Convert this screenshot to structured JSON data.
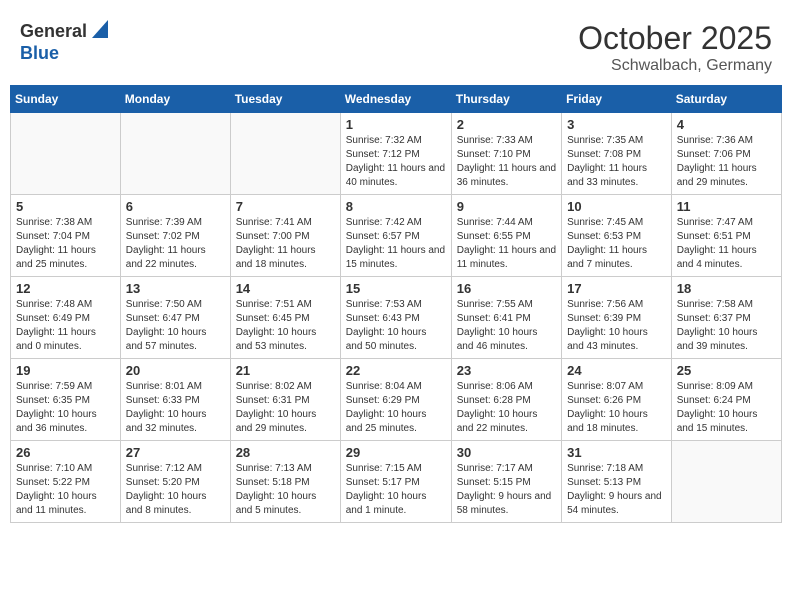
{
  "header": {
    "logo_general": "General",
    "logo_blue": "Blue",
    "month": "October 2025",
    "location": "Schwalbach, Germany"
  },
  "weekdays": [
    "Sunday",
    "Monday",
    "Tuesday",
    "Wednesday",
    "Thursday",
    "Friday",
    "Saturday"
  ],
  "weeks": [
    [
      {
        "day": "",
        "info": ""
      },
      {
        "day": "",
        "info": ""
      },
      {
        "day": "",
        "info": ""
      },
      {
        "day": "1",
        "info": "Sunrise: 7:32 AM\nSunset: 7:12 PM\nDaylight: 11 hours and 40 minutes."
      },
      {
        "day": "2",
        "info": "Sunrise: 7:33 AM\nSunset: 7:10 PM\nDaylight: 11 hours and 36 minutes."
      },
      {
        "day": "3",
        "info": "Sunrise: 7:35 AM\nSunset: 7:08 PM\nDaylight: 11 hours and 33 minutes."
      },
      {
        "day": "4",
        "info": "Sunrise: 7:36 AM\nSunset: 7:06 PM\nDaylight: 11 hours and 29 minutes."
      }
    ],
    [
      {
        "day": "5",
        "info": "Sunrise: 7:38 AM\nSunset: 7:04 PM\nDaylight: 11 hours and 25 minutes."
      },
      {
        "day": "6",
        "info": "Sunrise: 7:39 AM\nSunset: 7:02 PM\nDaylight: 11 hours and 22 minutes."
      },
      {
        "day": "7",
        "info": "Sunrise: 7:41 AM\nSunset: 7:00 PM\nDaylight: 11 hours and 18 minutes."
      },
      {
        "day": "8",
        "info": "Sunrise: 7:42 AM\nSunset: 6:57 PM\nDaylight: 11 hours and 15 minutes."
      },
      {
        "day": "9",
        "info": "Sunrise: 7:44 AM\nSunset: 6:55 PM\nDaylight: 11 hours and 11 minutes."
      },
      {
        "day": "10",
        "info": "Sunrise: 7:45 AM\nSunset: 6:53 PM\nDaylight: 11 hours and 7 minutes."
      },
      {
        "day": "11",
        "info": "Sunrise: 7:47 AM\nSunset: 6:51 PM\nDaylight: 11 hours and 4 minutes."
      }
    ],
    [
      {
        "day": "12",
        "info": "Sunrise: 7:48 AM\nSunset: 6:49 PM\nDaylight: 11 hours and 0 minutes."
      },
      {
        "day": "13",
        "info": "Sunrise: 7:50 AM\nSunset: 6:47 PM\nDaylight: 10 hours and 57 minutes."
      },
      {
        "day": "14",
        "info": "Sunrise: 7:51 AM\nSunset: 6:45 PM\nDaylight: 10 hours and 53 minutes."
      },
      {
        "day": "15",
        "info": "Sunrise: 7:53 AM\nSunset: 6:43 PM\nDaylight: 10 hours and 50 minutes."
      },
      {
        "day": "16",
        "info": "Sunrise: 7:55 AM\nSunset: 6:41 PM\nDaylight: 10 hours and 46 minutes."
      },
      {
        "day": "17",
        "info": "Sunrise: 7:56 AM\nSunset: 6:39 PM\nDaylight: 10 hours and 43 minutes."
      },
      {
        "day": "18",
        "info": "Sunrise: 7:58 AM\nSunset: 6:37 PM\nDaylight: 10 hours and 39 minutes."
      }
    ],
    [
      {
        "day": "19",
        "info": "Sunrise: 7:59 AM\nSunset: 6:35 PM\nDaylight: 10 hours and 36 minutes."
      },
      {
        "day": "20",
        "info": "Sunrise: 8:01 AM\nSunset: 6:33 PM\nDaylight: 10 hours and 32 minutes."
      },
      {
        "day": "21",
        "info": "Sunrise: 8:02 AM\nSunset: 6:31 PM\nDaylight: 10 hours and 29 minutes."
      },
      {
        "day": "22",
        "info": "Sunrise: 8:04 AM\nSunset: 6:29 PM\nDaylight: 10 hours and 25 minutes."
      },
      {
        "day": "23",
        "info": "Sunrise: 8:06 AM\nSunset: 6:28 PM\nDaylight: 10 hours and 22 minutes."
      },
      {
        "day": "24",
        "info": "Sunrise: 8:07 AM\nSunset: 6:26 PM\nDaylight: 10 hours and 18 minutes."
      },
      {
        "day": "25",
        "info": "Sunrise: 8:09 AM\nSunset: 6:24 PM\nDaylight: 10 hours and 15 minutes."
      }
    ],
    [
      {
        "day": "26",
        "info": "Sunrise: 7:10 AM\nSunset: 5:22 PM\nDaylight: 10 hours and 11 minutes."
      },
      {
        "day": "27",
        "info": "Sunrise: 7:12 AM\nSunset: 5:20 PM\nDaylight: 10 hours and 8 minutes."
      },
      {
        "day": "28",
        "info": "Sunrise: 7:13 AM\nSunset: 5:18 PM\nDaylight: 10 hours and 5 minutes."
      },
      {
        "day": "29",
        "info": "Sunrise: 7:15 AM\nSunset: 5:17 PM\nDaylight: 10 hours and 1 minute."
      },
      {
        "day": "30",
        "info": "Sunrise: 7:17 AM\nSunset: 5:15 PM\nDaylight: 9 hours and 58 minutes."
      },
      {
        "day": "31",
        "info": "Sunrise: 7:18 AM\nSunset: 5:13 PM\nDaylight: 9 hours and 54 minutes."
      },
      {
        "day": "",
        "info": ""
      }
    ]
  ]
}
